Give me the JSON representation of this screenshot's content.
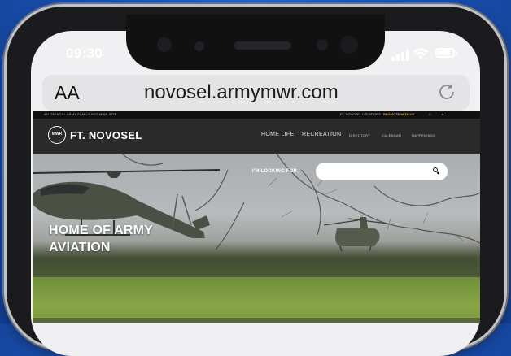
{
  "status_bar": {
    "time": "09:30",
    "battery_level": 0.85
  },
  "browser": {
    "text_size_label": "AA",
    "url": "novosel.armymwr.com"
  },
  "site": {
    "top_strip": {
      "left_text": "AN OFFICIAL ARMY FAMILY AND MWR SITE",
      "links": [
        "FT. NOVOSEL LOCATIONS",
        "PROMOTE WITH US"
      ]
    },
    "brand": "FT. NOVOSEL",
    "logo_text": "MWR",
    "nav_primary": [
      "HOME LIFE",
      "RECREATION"
    ],
    "nav_secondary": [
      "DIRECTORY",
      "CALENDAR",
      "HAPPENINGS"
    ],
    "search": {
      "label": "I'M LOOKING FOR",
      "placeholder": ""
    },
    "hero": {
      "headline_line1": "HOME OF ARMY",
      "headline_line2": "AVIATION"
    }
  },
  "colors": {
    "background": "#1a4fb0",
    "nav_bar": "#2a2a2a",
    "accent_link": "#e0a23a",
    "grass": "#7c9a40"
  }
}
